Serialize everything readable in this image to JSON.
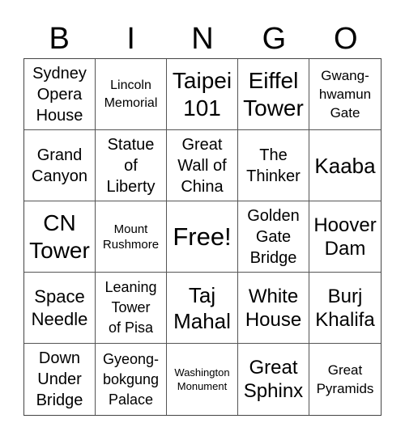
{
  "header": [
    "B",
    "I",
    "N",
    "G",
    "O"
  ],
  "cells": [
    {
      "text": "Sydney\nOpera\nHouse",
      "size": "s20"
    },
    {
      "text": "Lincoln\nMemorial",
      "size": "s16"
    },
    {
      "text": "Taipei\n101",
      "size": "s28"
    },
    {
      "text": "Eiffel\nTower",
      "size": "s28"
    },
    {
      "text": "Gwang-\nhwamun\nGate",
      "size": "s17"
    },
    {
      "text": "Grand\nCanyon",
      "size": "s20"
    },
    {
      "text": "Statue\nof\nLiberty",
      "size": "s20"
    },
    {
      "text": "Great\nWall of\nChina",
      "size": "s20"
    },
    {
      "text": "The\nThinker",
      "size": "s20"
    },
    {
      "text": "Kaaba",
      "size": "s26"
    },
    {
      "text": "CN\nTower",
      "size": "s28"
    },
    {
      "text": "Mount\nRushmore",
      "size": "s15"
    },
    {
      "text": "Free!",
      "size": "s30"
    },
    {
      "text": "Golden\nGate\nBridge",
      "size": "s20"
    },
    {
      "text": "Hoover\nDam",
      "size": "s24"
    },
    {
      "text": "Space\nNeedle",
      "size": "s22"
    },
    {
      "text": "Leaning\nTower\nof Pisa",
      "size": "s18"
    },
    {
      "text": "Taj\nMahal",
      "size": "s26"
    },
    {
      "text": "White\nHouse",
      "size": "s24"
    },
    {
      "text": "Burj\nKhalifa",
      "size": "s24"
    },
    {
      "text": "Down\nUnder\nBridge",
      "size": "s20"
    },
    {
      "text": "Gyeong-\nbokgung\nPalace",
      "size": "s18"
    },
    {
      "text": "Washington\nMonument",
      "size": "s13"
    },
    {
      "text": "Great\nSphinx",
      "size": "s24"
    },
    {
      "text": "Great\nPyramids",
      "size": "s17"
    }
  ]
}
